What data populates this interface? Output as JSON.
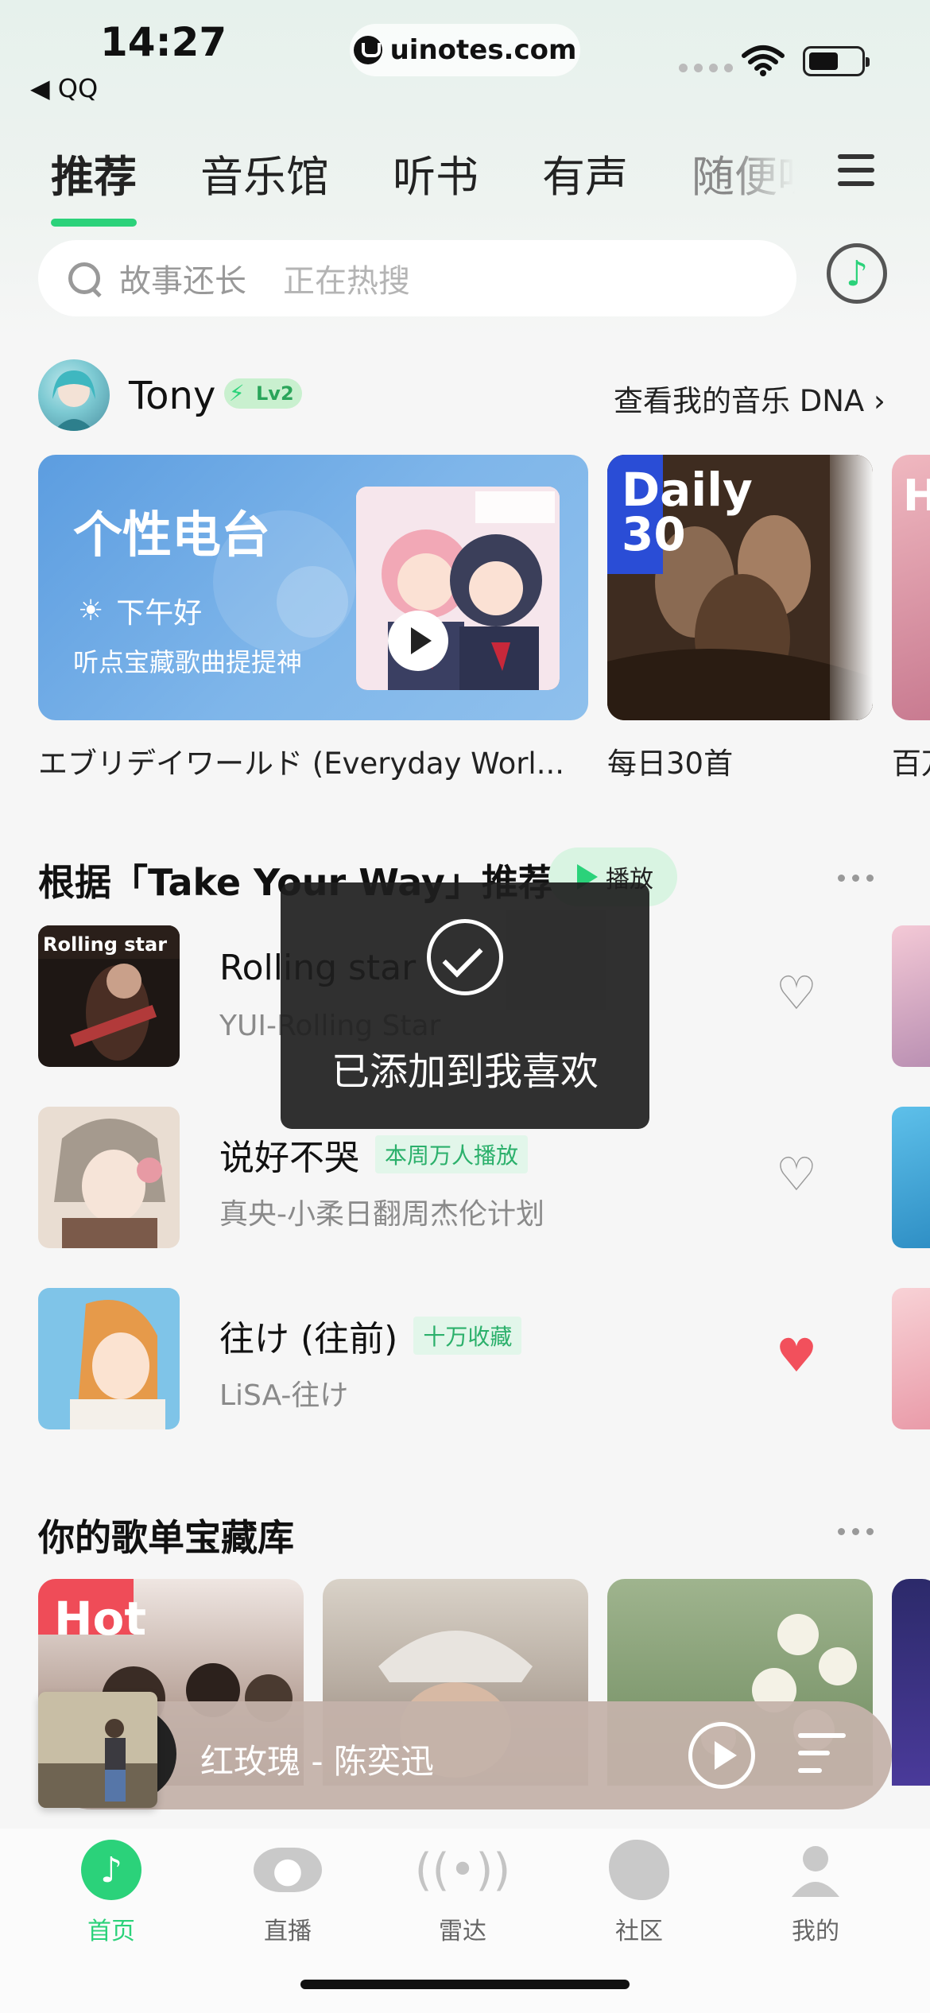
{
  "status_bar": {
    "time": "14:27",
    "back_app": "◀ QQ",
    "url": "uinotes.com"
  },
  "tabs": [
    {
      "label": "推荐",
      "active": true
    },
    {
      "label": "音乐馆",
      "active": false
    },
    {
      "label": "听书",
      "active": false
    },
    {
      "label": "有声",
      "active": false
    },
    {
      "label": "随便听",
      "active": false
    }
  ],
  "search": {
    "placeholder": "故事还长",
    "hint": "正在热搜"
  },
  "user": {
    "name": "Tony",
    "level": "Lv2",
    "dna_link": "查看我的音乐 DNA"
  },
  "cards": {
    "radio": {
      "title": "个性电台",
      "weather": "下午好",
      "subtitle": "听点宝藏歌曲提提神",
      "caption": "エブリデイワールド (Everyday Worl..."
    },
    "daily": {
      "badge_line1": "Daily",
      "badge_line2": "30",
      "caption": "每日30首"
    },
    "partial": {
      "badge": "H",
      "caption": "百万"
    }
  },
  "recommend": {
    "title": "根据「Take Your Way」推荐",
    "play_label": "播放",
    "songs": [
      {
        "title": "Rolling star",
        "tag": "",
        "subtitle": "YUI-Rolling Star",
        "liked": false
      },
      {
        "title": "说好不哭",
        "tag": "本周万人播放",
        "subtitle": "真央-小柔日翻周杰伦计划",
        "liked": false
      },
      {
        "title": "往け (往前)",
        "tag": "十万收藏",
        "subtitle": "LiSA-往け",
        "liked": true
      }
    ]
  },
  "toast": {
    "text": "已添加到我喜欢"
  },
  "playlists": {
    "title": "你的歌单宝藏库",
    "hot_label": "Hot"
  },
  "mini_player": {
    "now_playing": "红玫瑰 - 陈奕迅"
  },
  "bottom_nav": [
    {
      "label": "首页",
      "icon": "music-note-icon",
      "active": true
    },
    {
      "label": "直播",
      "icon": "eye-icon",
      "active": false
    },
    {
      "label": "雷达",
      "icon": "radar-icon",
      "active": false
    },
    {
      "label": "社区",
      "icon": "community-icon",
      "active": false
    },
    {
      "label": "我的",
      "icon": "profile-icon",
      "active": false
    }
  ],
  "colors": {
    "accent": "#2bd27a",
    "liked": "#f2505c",
    "radio_card": "#6aa7e4",
    "mini_player": "#c4b2aa"
  }
}
